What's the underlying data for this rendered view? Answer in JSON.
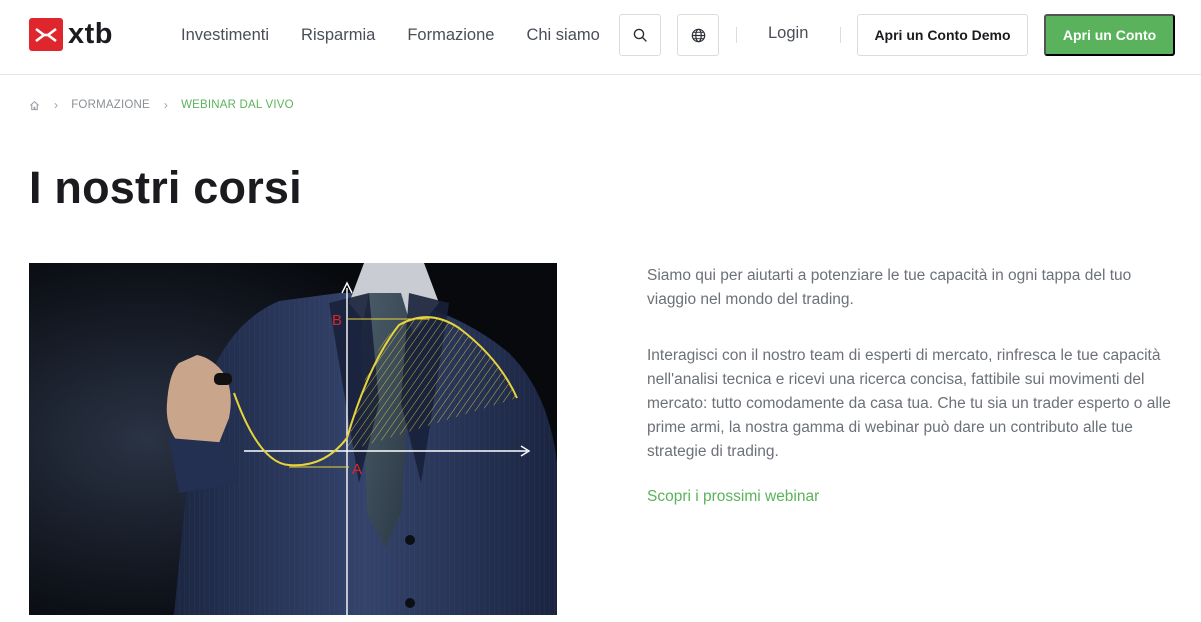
{
  "brand": {
    "name": "xtb",
    "accent": "#e0262d"
  },
  "nav": {
    "items": [
      "Investimenti",
      "Risparmia",
      "Formazione",
      "Chi siamo"
    ],
    "search_icon": "search-icon",
    "language_icon": "globe-icon",
    "login_label": "Login",
    "demo_button_label": "Apri un Conto Demo",
    "open_button_label": "Apri un Conto"
  },
  "breadcrumb": {
    "home_icon": "home-icon",
    "items": [
      "FORMAZIONE",
      "WEBINAR DAL VIVO"
    ]
  },
  "page": {
    "title": "I nostri corsi",
    "paragraphs": [
      "Siamo qui per aiutarti a potenziare le tue capacità in ogni tappa del tuo viaggio nel mondo del trading.",
      "Interagisci con il nostro team di esperti di mercato, rinfresca le tue capacità nell'analisi tecnica e ricevi una ricerca concisa, fattibile sui movimenti del mercato: tutto comodamente da casa tua. Che tu sia un trader esperto o alle prime armi, la nostra gamma di webinar può dare un contributo alle tue strategie di trading."
    ],
    "cta_label": "Scopri i prossimi webinar"
  },
  "hero_image": {
    "label_b": "B",
    "label_a": "A"
  },
  "colors": {
    "green": "#5ab35c",
    "text_muted": "#6c7178",
    "chart_yellow": "#e8d43a",
    "chart_label_red": "#d8262e"
  }
}
